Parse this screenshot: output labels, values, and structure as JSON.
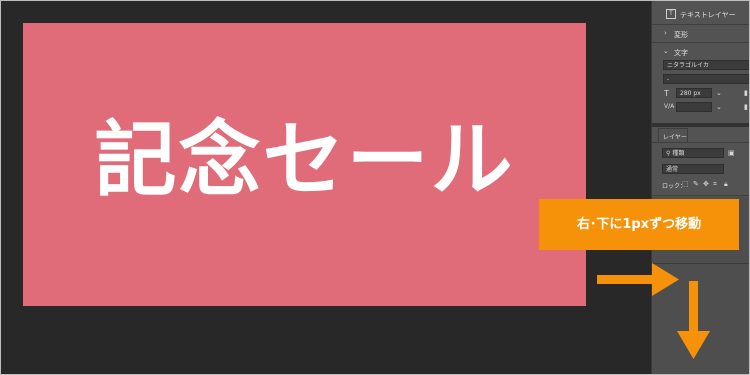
{
  "canvas": {
    "headline": "記念セール",
    "artboard_color": "#e06b79",
    "background_color": "#282828"
  },
  "panel": {
    "layer_type": "テキストレイヤー",
    "sections": {
      "transform": "変形",
      "text": "文字"
    },
    "font_family": "ニタラゴルイカ",
    "font_style": "-",
    "font_size": "280 px",
    "layers_tab": "レイヤー",
    "filter_label": "種類",
    "blend_mode": "通常",
    "lock_label": "ロック："
  },
  "callout": {
    "text": "右･下に1pxずつ移動",
    "color": "#f5920a"
  },
  "arrows": {
    "color": "#f5920a",
    "directions": [
      "right",
      "down"
    ]
  }
}
